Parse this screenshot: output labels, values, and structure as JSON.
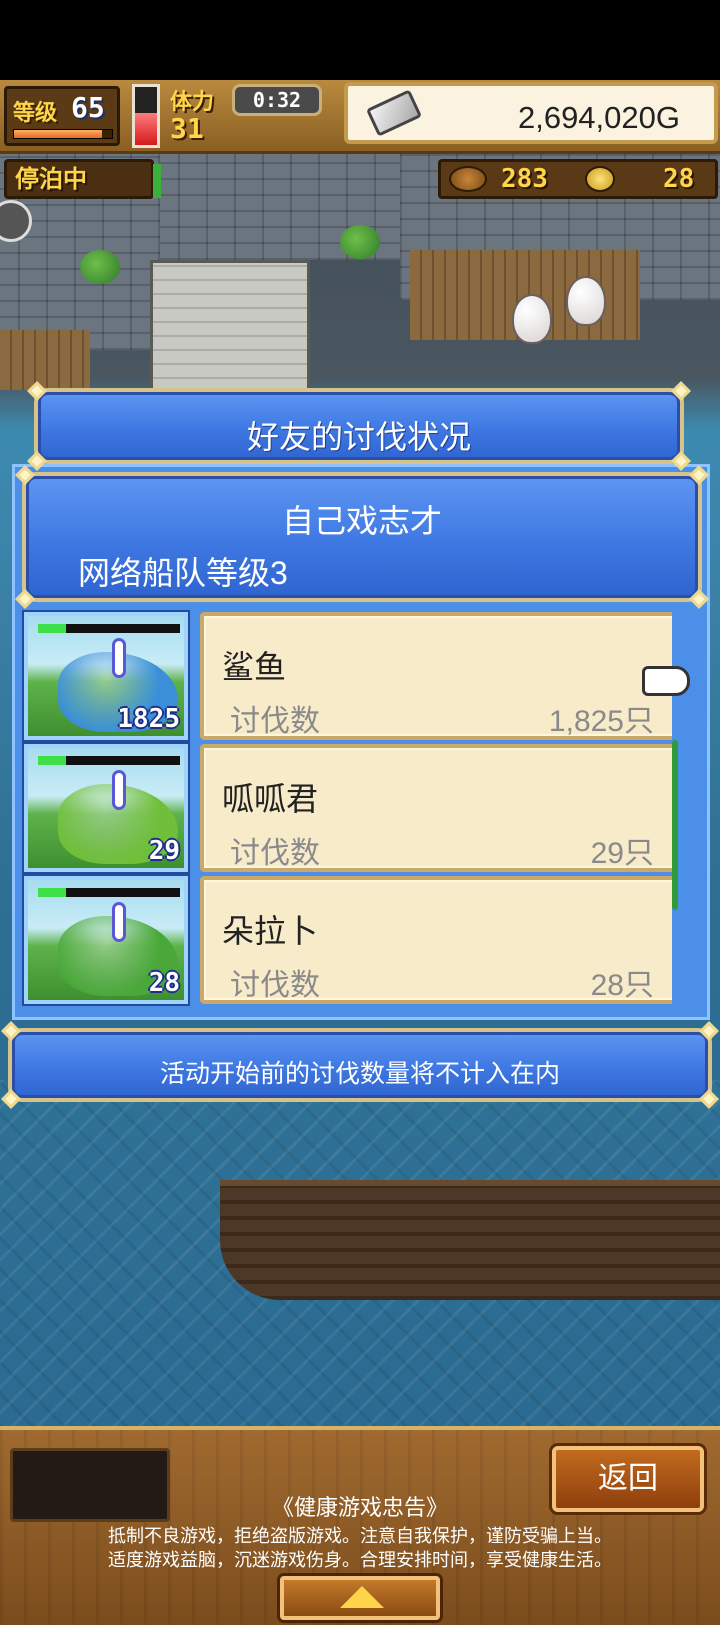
{
  "hud": {
    "level_label": "等级",
    "level_value": "65",
    "level_progress": 0.9,
    "stamina_label": "体力",
    "stamina_value": "31",
    "stamina_level": 0.55,
    "timer": "0:32",
    "gold": "2,694,020G",
    "status": "停泊中",
    "resource_1": "283",
    "resource_2": "28"
  },
  "dialog": {
    "title": "好友的讨伐状况",
    "friend_name": "自己戏志才",
    "fleet_level": "网络船队等级3",
    "kills_label": "讨伐数",
    "monsters": [
      {
        "name": "鲨鱼",
        "kills": "1,825只",
        "badge": "1825",
        "hp": 0.2,
        "color": "#3a8fd8"
      },
      {
        "name": "呱呱君",
        "kills": "29只",
        "badge": "29",
        "hp": 0.2,
        "color": "#6fbf3a"
      },
      {
        "name": "朵拉卜",
        "kills": "28只",
        "badge": "28",
        "hp": 0.2,
        "color": "#4aa83a"
      }
    ],
    "notice": "活动开始前的讨伐数量将不计入在内"
  },
  "bottom": {
    "back_label": "返回",
    "health_title": "《健康游戏忠告》",
    "health_line_1": "抵制不良游戏，拒绝盗版游戏。注意自我保护，谨防受骗上当。",
    "health_line_2": "适度游戏益脑，沉迷游戏伤身。合理安排时间，享受健康生活。"
  }
}
